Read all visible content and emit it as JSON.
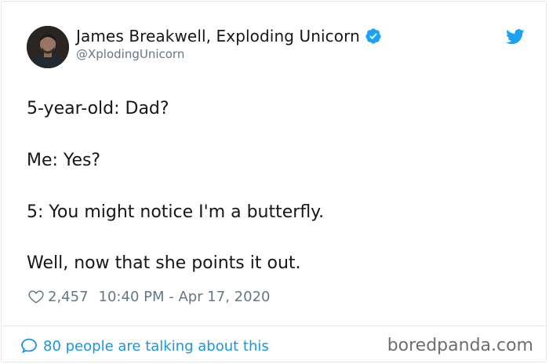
{
  "author": {
    "display_name": "James Breakwell, Exploding Unicorn",
    "handle": "@XplodingUnicorn"
  },
  "tweet": {
    "lines": [
      "5-year-old: Dad?",
      "Me: Yes?",
      "5: You might notice I'm a butterfly.",
      "Well, now that she points it out."
    ],
    "likes": "2,457",
    "timestamp": "10:40 PM - Apr 17, 2020"
  },
  "footer": {
    "conversation_link": "80 people are talking about this"
  },
  "watermark": "boredpanda.com",
  "icons": {
    "verified": "verified-badge-icon",
    "twitter": "twitter-bird-icon",
    "like": "heart-icon",
    "reply": "speech-bubble-icon"
  },
  "colors": {
    "text": "#14171a",
    "secondary": "#657786",
    "accent": "#1da1f2",
    "link": "#1b95e0",
    "border": "#e1e8ed"
  }
}
